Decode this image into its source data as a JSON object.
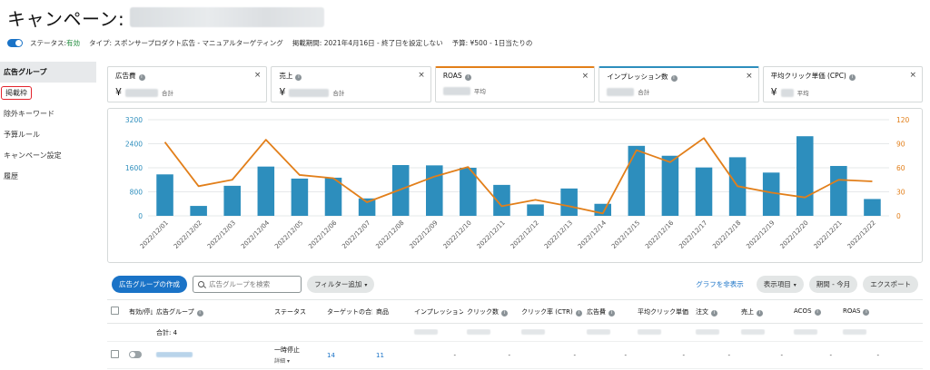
{
  "header": {
    "title": "キャンペーン:",
    "status_label": "ステータス:",
    "status_value": "有効",
    "type_label": "タイプ: スポンサープロダクト広告 - マニュアルターゲティング",
    "period_label": "掲載期間: 2021年4月16日 - 終了日を設定しない",
    "budget_label": "予算: ¥500 - 1日当たりの"
  },
  "sidebar": {
    "items": [
      {
        "label": "広告グループ"
      },
      {
        "label": "掲載枠"
      },
      {
        "label": "除外キーワード"
      },
      {
        "label": "予算ルール"
      },
      {
        "label": "キャンペーン設定"
      },
      {
        "label": "履歴"
      }
    ]
  },
  "cards": [
    {
      "label": "広告費",
      "currency": "¥",
      "sub": "合計",
      "color": ""
    },
    {
      "label": "売上",
      "currency": "¥",
      "sub": "合計",
      "color": ""
    },
    {
      "label": "ROAS",
      "currency": "",
      "sub": "平均",
      "color": "#e27f1a"
    },
    {
      "label": "インプレッション数",
      "currency": "",
      "sub": "合計",
      "color": "#2d8ebd"
    },
    {
      "label": "平均クリック単価 (CPC)",
      "currency": "¥",
      "sub": "平均",
      "color": ""
    }
  ],
  "close_glyph": "×",
  "chart_data": {
    "type": "bar",
    "categories": [
      "2022/12/01",
      "2022/12/02",
      "2022/12/03",
      "2022/12/04",
      "2022/12/05",
      "2022/12/06",
      "2022/12/07",
      "2022/12/08",
      "2022/12/09",
      "2022/12/10",
      "2022/12/11",
      "2022/12/12",
      "2022/12/13",
      "2022/12/14",
      "2022/12/15",
      "2022/12/16",
      "2022/12/17",
      "2022/12/18",
      "2022/12/19",
      "2022/12/20",
      "2022/12/21",
      "2022/12/22"
    ],
    "series": [
      {
        "type": "bar",
        "axis": "left",
        "color": "#2d8ebd",
        "values": [
          1380,
          330,
          1000,
          1640,
          1240,
          1270,
          580,
          1690,
          1680,
          1600,
          1030,
          380,
          910,
          400,
          2330,
          2000,
          1610,
          1950,
          1440,
          2650,
          1660,
          560
        ]
      },
      {
        "type": "line",
        "axis": "right",
        "color": "#e27f1a",
        "values": [
          92,
          37,
          45,
          95,
          51,
          47,
          17,
          33,
          49,
          61,
          12,
          20,
          12,
          3,
          82,
          67,
          97,
          37,
          29,
          23,
          45,
          43
        ]
      }
    ],
    "yleft": {
      "min": 0,
      "max": 3200,
      "ticks": [
        0,
        800,
        1600,
        2400,
        3200
      ]
    },
    "yright": {
      "min": 0,
      "max": 120,
      "ticks": [
        0,
        30,
        60,
        90,
        120
      ]
    },
    "grid": true
  },
  "toolbar": {
    "create_label": "広告グループの作成",
    "search_placeholder": "広告グループを検索",
    "filter_label": "フィルター追加",
    "hide_graph_label": "グラフを非表示",
    "display_items_label": "表示項目",
    "period_label": "期間 - 今月",
    "export_label": "エクスポート",
    "caret_glyph": "▾"
  },
  "table": {
    "headers": [
      "有効/停止",
      "広告グループ",
      "ステータス",
      "ターゲットの合計",
      "商品",
      "インプレッション",
      "クリック数",
      "クリック率 (CTR)",
      "広告費",
      "平均クリック単価",
      "注文",
      "売上",
      "ACOS",
      "ROAS"
    ],
    "total_label": "合計: 4",
    "rows": [
      {
        "status": "一時停止",
        "detail": "詳細",
        "targets": "14",
        "products": "11",
        "dash": "-"
      }
    ]
  }
}
